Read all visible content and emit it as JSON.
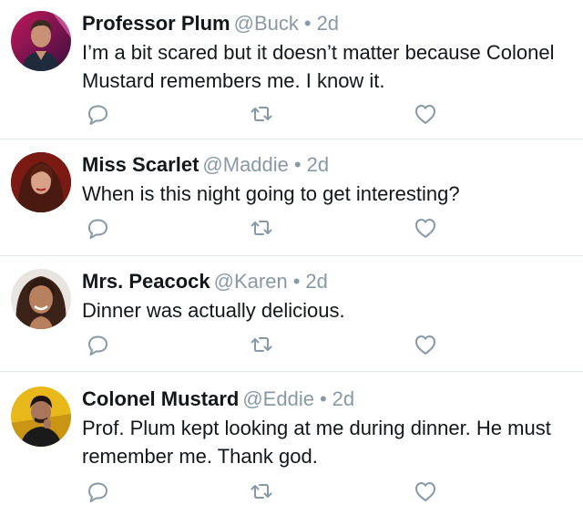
{
  "tweets": [
    {
      "name": "Professor Plum",
      "handle": "@Buck",
      "separator": "•",
      "time": "2d",
      "text": "I’m a bit scared but it doesn’t matter because Colonel Mustard remembers me. I know it.",
      "avatar_icon": "professor-plum-avatar"
    },
    {
      "name": "Miss Scarlet",
      "handle": "@Maddie",
      "separator": "•",
      "time": "2d",
      "text": "When is this night going to get interesting?",
      "avatar_icon": "miss-scarlet-avatar"
    },
    {
      "name": "Mrs. Peacock",
      "handle": "@Karen",
      "separator": "•",
      "time": "2d",
      "text": "Dinner was actually delicious.",
      "avatar_icon": "mrs-peacock-avatar"
    },
    {
      "name": "Colonel Mustard",
      "handle": "@Eddie",
      "separator": "•",
      "time": "2d",
      "text": "Prof. Plum kept looking at me during dinner. He must remember me. Thank god.",
      "avatar_icon": "colonel-mustard-avatar"
    }
  ],
  "icons": {
    "reply": "speech-bubble-icon",
    "retweet": "retweet-arrows-icon",
    "like": "heart-outline-icon"
  },
  "colors": {
    "name": "#14171a",
    "meta": "#8899a6",
    "icon": "#8899a6",
    "divider": "#e1e8ed"
  }
}
